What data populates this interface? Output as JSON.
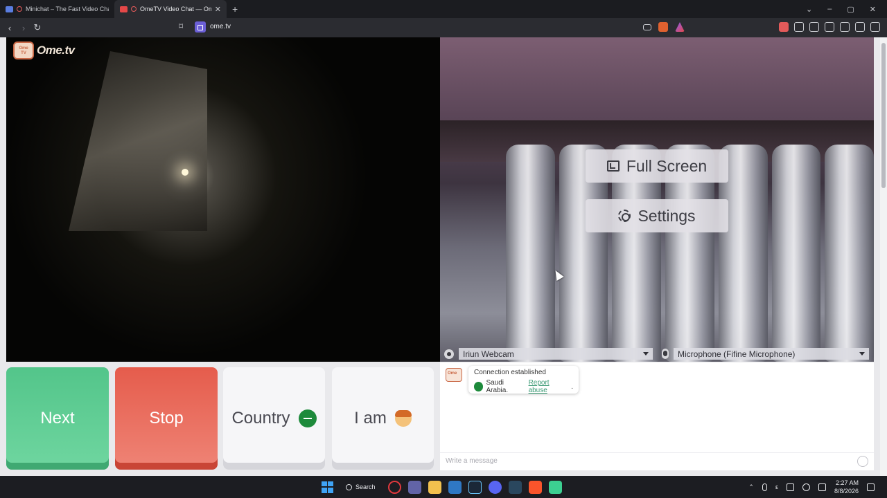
{
  "browser": {
    "tabs": [
      {
        "label": "Minichat – The Fast Video Chat",
        "active": false
      },
      {
        "label": "OmeTV Video Chat — Omeg",
        "active": true
      }
    ],
    "new_tab": "+",
    "url": "ome.tv"
  },
  "page": {
    "logo_text": "Ome.tv",
    "overlay": {
      "fullscreen_label": "Full Screen",
      "settings_label": "Settings"
    },
    "devices": {
      "camera": "Iriun Webcam",
      "microphone": "Microphone (Fifine Microphone)"
    },
    "buttons": {
      "next": "Next",
      "stop": "Stop",
      "country": "Country",
      "iam": "I am"
    },
    "chat": {
      "status": "Connection established",
      "country_text": "Saudi Arabia.",
      "report_link": "Report abuse",
      "report_suffix": ".",
      "placeholder": "Write a message"
    }
  },
  "taskbar": {
    "search_label": "Search",
    "time": "2:27 AM",
    "date": "8/8/2026",
    "lang": "ε"
  },
  "colors": {
    "next": "#53c58a",
    "stop": "#e55c4c",
    "report_link": "#3a9a74"
  }
}
